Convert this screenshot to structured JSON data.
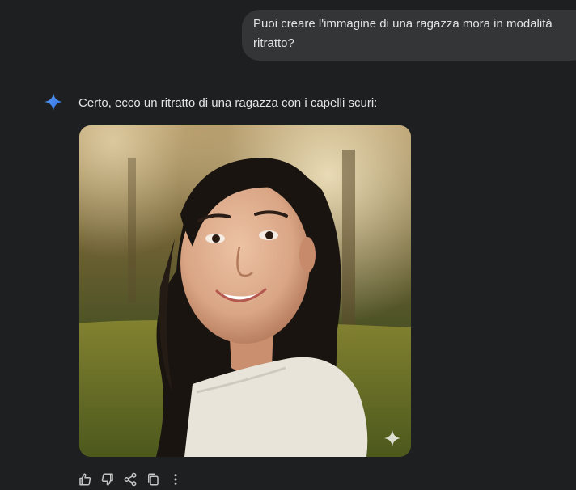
{
  "conversation": {
    "user_message": "Puoi creare l'immagine di una ragazza mora in modalità\nritratto?",
    "assistant_reply": "Certo, ecco un ritratto di una ragazza con i capelli scuri:",
    "assistant_icon": "gemini-sparkle-icon",
    "generated_image": {
      "description_icon": "watermark-sparkle-icon"
    }
  },
  "actions": [
    {
      "name": "thumbs-up-icon"
    },
    {
      "name": "thumbs-down-icon"
    },
    {
      "name": "share-icon"
    },
    {
      "name": "copy-icon"
    },
    {
      "name": "more-options-icon"
    }
  ],
  "colors": {
    "background": "#1e1f20",
    "bubble": "#333537",
    "text": "#e3e3e3",
    "icon": "#c4c7c5",
    "gemini_blue": "#4b8df8"
  }
}
